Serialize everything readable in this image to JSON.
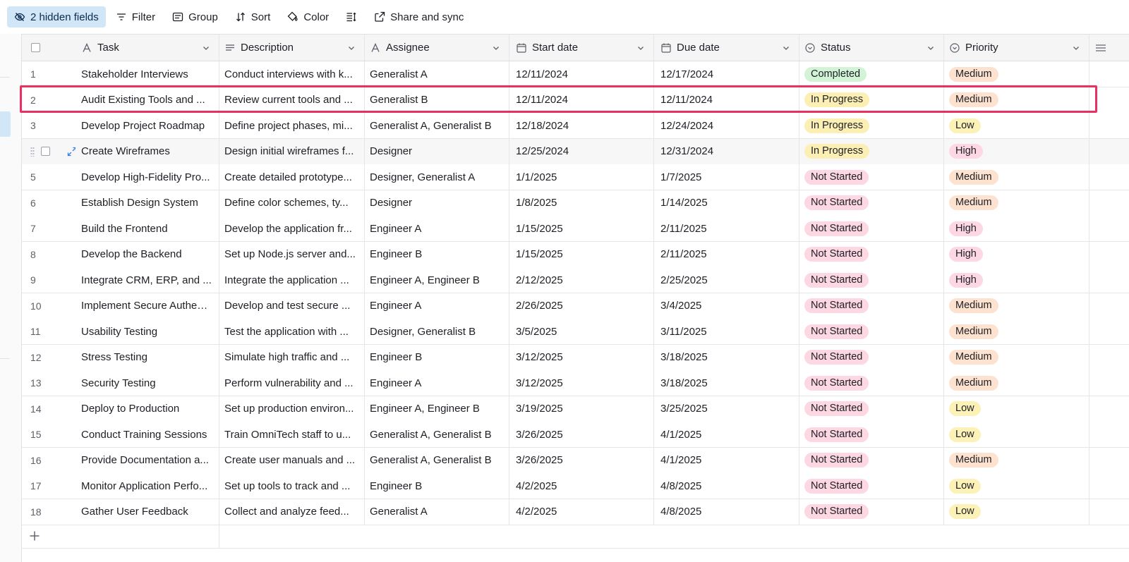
{
  "toolbar": {
    "hidden_fields_label": "2 hidden fields",
    "filter_label": "Filter",
    "group_label": "Group",
    "sort_label": "Sort",
    "color_label": "Color",
    "share_label": "Share and sync"
  },
  "columns": {
    "task": "Task",
    "description": "Description",
    "assignee": "Assignee",
    "start_date": "Start date",
    "due_date": "Due date",
    "status": "Status",
    "priority": "Priority"
  },
  "colors": {
    "completed": "#d2f3d6",
    "in_progress": "#fcefb4",
    "not_started": "#fdd7e1",
    "medium": "#fde2cf",
    "high": "#fdd7e4",
    "low": "#fcf1b6",
    "highlight": "#ec2f62"
  },
  "rows": [
    {
      "num": "1",
      "task": "Stakeholder Interviews",
      "description": "Conduct interviews with k...",
      "assignee": "Generalist A",
      "start": "12/11/2024",
      "due": "12/17/2024",
      "status": "Completed",
      "priority": "Medium"
    },
    {
      "num": "2",
      "task": "Audit Existing Tools and ...",
      "description": "Review current tools and ...",
      "assignee": "Generalist B",
      "start": "12/11/2024",
      "due": "12/11/2024",
      "status": "In Progress",
      "priority": "Medium"
    },
    {
      "num": "3",
      "task": "Develop Project Roadmap",
      "description": "Define project phases, mi...",
      "assignee": "Generalist A, Generalist B",
      "start": "12/18/2024",
      "due": "12/24/2024",
      "status": "In Progress",
      "priority": "Low"
    },
    {
      "num": "",
      "task": "Create Wireframes",
      "description": "Design initial wireframes f...",
      "assignee": "Designer",
      "start": "12/25/2024",
      "due": "12/31/2024",
      "status": "In Progress",
      "priority": "High"
    },
    {
      "num": "5",
      "task": "Develop High-Fidelity Pro...",
      "description": "Create detailed prototype...",
      "assignee": "Designer, Generalist A",
      "start": "1/1/2025",
      "due": "1/7/2025",
      "status": "Not Started",
      "priority": "Medium"
    },
    {
      "num": "6",
      "task": "Establish Design System",
      "description": "Define color schemes, ty...",
      "assignee": "Designer",
      "start": "1/8/2025",
      "due": "1/14/2025",
      "status": "Not Started",
      "priority": "Medium"
    },
    {
      "num": "7",
      "task": "Build the Frontend",
      "description": "Develop the application fr...",
      "assignee": "Engineer A",
      "start": "1/15/2025",
      "due": "2/11/2025",
      "status": "Not Started",
      "priority": "High"
    },
    {
      "num": "8",
      "task": "Develop the Backend",
      "description": "Set up Node.js server and...",
      "assignee": "Engineer B",
      "start": "1/15/2025",
      "due": "2/11/2025",
      "status": "Not Started",
      "priority": "High"
    },
    {
      "num": "9",
      "task": "Integrate CRM, ERP, and ...",
      "description": "Integrate the application ...",
      "assignee": "Engineer A, Engineer B",
      "start": "2/12/2025",
      "due": "2/25/2025",
      "status": "Not Started",
      "priority": "High"
    },
    {
      "num": "10",
      "task": "Implement Secure Authen...",
      "description": "Develop and test secure ...",
      "assignee": "Engineer A",
      "start": "2/26/2025",
      "due": "3/4/2025",
      "status": "Not Started",
      "priority": "Medium"
    },
    {
      "num": "11",
      "task": "Usability Testing",
      "description": "Test the application with ...",
      "assignee": "Designer, Generalist B",
      "start": "3/5/2025",
      "due": "3/11/2025",
      "status": "Not Started",
      "priority": "Medium"
    },
    {
      "num": "12",
      "task": "Stress Testing",
      "description": "Simulate high traffic and ...",
      "assignee": "Engineer B",
      "start": "3/12/2025",
      "due": "3/18/2025",
      "status": "Not Started",
      "priority": "Medium"
    },
    {
      "num": "13",
      "task": "Security Testing",
      "description": "Perform vulnerability and ...",
      "assignee": "Engineer A",
      "start": "3/12/2025",
      "due": "3/18/2025",
      "status": "Not Started",
      "priority": "Medium"
    },
    {
      "num": "14",
      "task": "Deploy to Production",
      "description": "Set up production environ...",
      "assignee": "Engineer A, Engineer B",
      "start": "3/19/2025",
      "due": "3/25/2025",
      "status": "Not Started",
      "priority": "Low"
    },
    {
      "num": "15",
      "task": "Conduct Training Sessions",
      "description": "Train OmniTech staff to u...",
      "assignee": "Generalist A, Generalist B",
      "start": "3/26/2025",
      "due": "4/1/2025",
      "status": "Not Started",
      "priority": "Low"
    },
    {
      "num": "16",
      "task": "Provide Documentation a...",
      "description": "Create user manuals and ...",
      "assignee": "Generalist A, Generalist B",
      "start": "3/26/2025",
      "due": "4/1/2025",
      "status": "Not Started",
      "priority": "Medium"
    },
    {
      "num": "17",
      "task": "Monitor Application Perfo...",
      "description": "Set up tools to track and ...",
      "assignee": "Engineer B",
      "start": "4/2/2025",
      "due": "4/8/2025",
      "status": "Not Started",
      "priority": "Low"
    },
    {
      "num": "18",
      "task": "Gather User Feedback",
      "description": "Collect and analyze feed...",
      "assignee": "Generalist A",
      "start": "4/2/2025",
      "due": "4/8/2025",
      "status": "Not Started",
      "priority": "Low"
    }
  ]
}
